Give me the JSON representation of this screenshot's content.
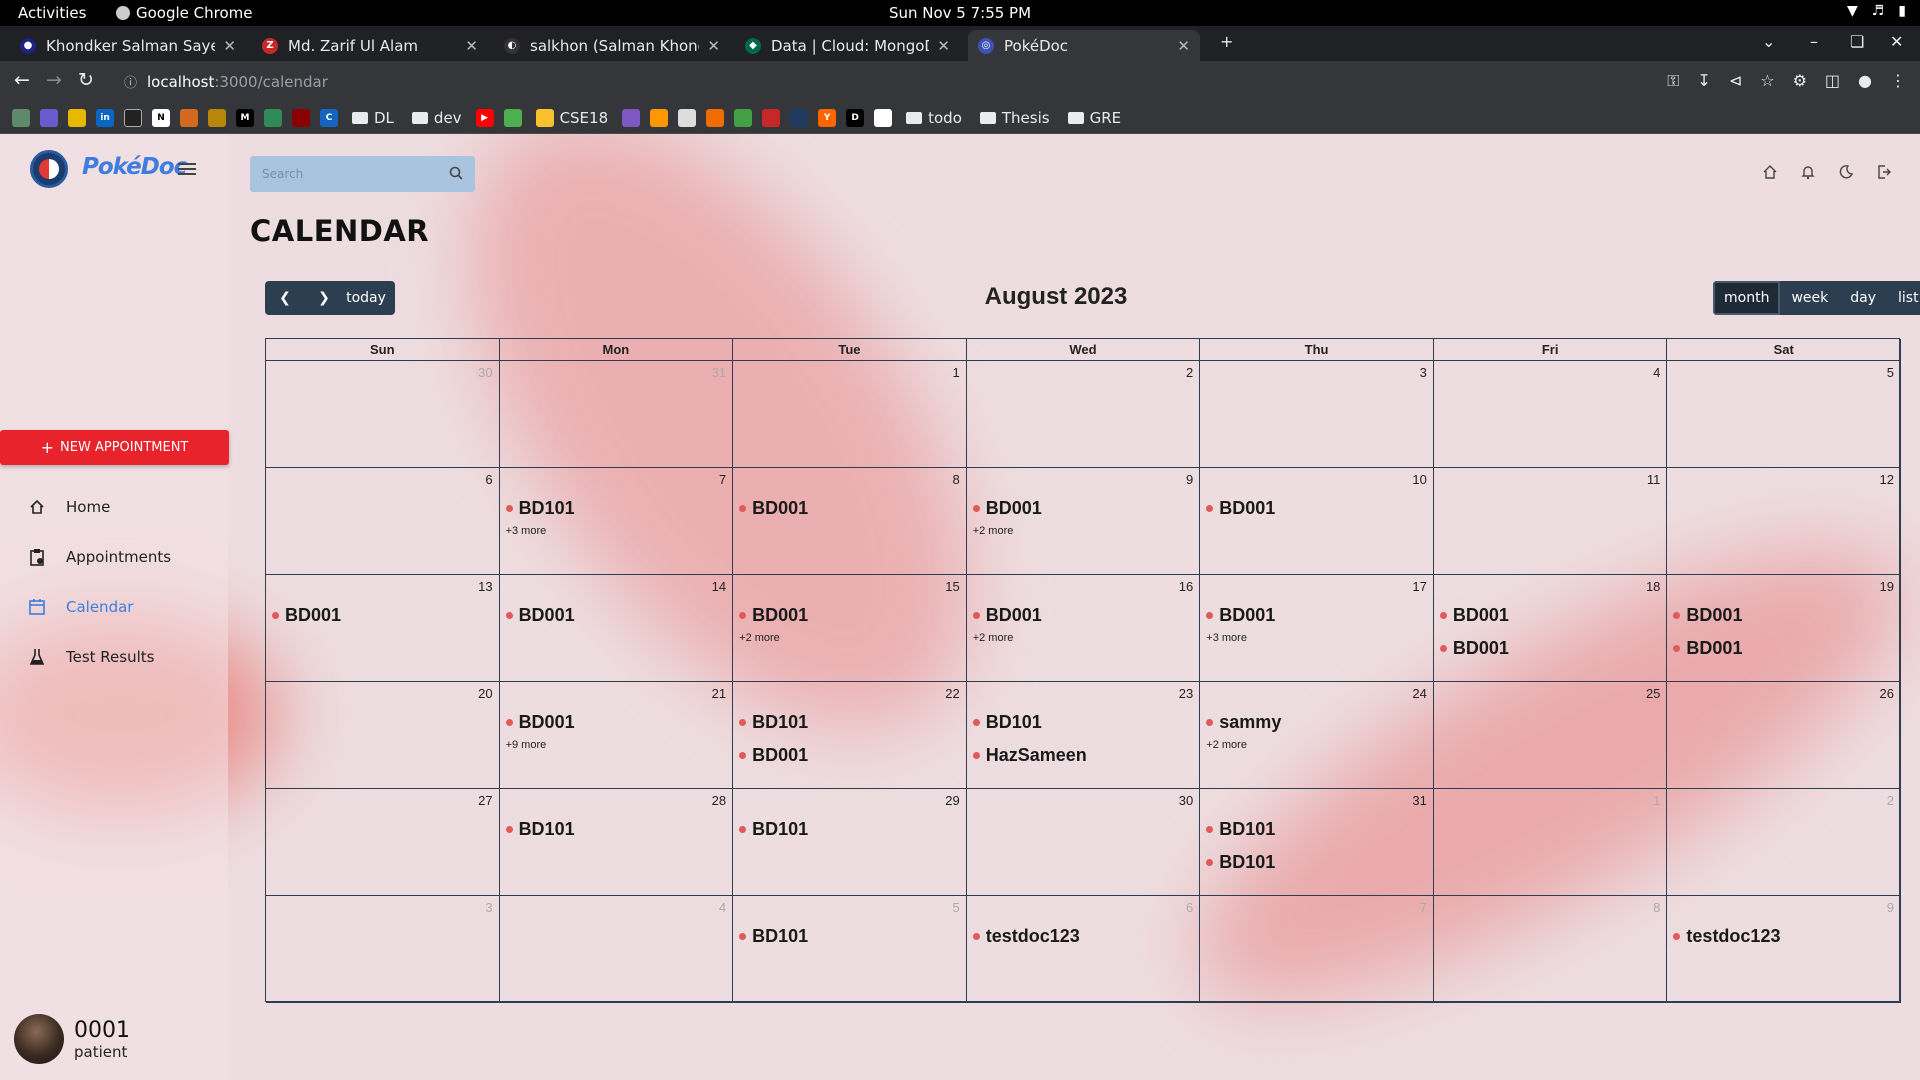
{
  "os_bar": {
    "activities": "Activities",
    "app_name": "Google Chrome",
    "clock": "Sun Nov 5   7:55 PM"
  },
  "tabs": [
    {
      "title": "Khondker Salman Sayeed",
      "fav_color": "#1a237e",
      "fav_glyph": "●"
    },
    {
      "title": "Md. Zarif Ul Alam",
      "fav_color": "#c62828",
      "fav_glyph": "Z"
    },
    {
      "title": "salkhon (Salman Khondk",
      "fav_color": "#333333",
      "fav_glyph": "◐"
    },
    {
      "title": "Data | Cloud: MongoDB C",
      "fav_color": "#00684a",
      "fav_glyph": "◆"
    },
    {
      "title": "PokéDoc",
      "fav_color": "#3f51b5",
      "fav_glyph": "◎"
    }
  ],
  "address": {
    "host": "localhost",
    "path": ":3000/calendar"
  },
  "bookmark_folders": [
    "DL",
    "dev",
    "CSE18",
    "todo",
    "Thesis",
    "GRE"
  ],
  "app": {
    "brand": "PokéDoc"
  },
  "sidebar": {
    "new_button": "NEW APPOINTMENT",
    "items": [
      {
        "label": "Home",
        "icon": "home-icon"
      },
      {
        "label": "Appointments",
        "icon": "clipboard-icon"
      },
      {
        "label": "Calendar",
        "icon": "calendar-icon",
        "selected": true
      },
      {
        "label": "Test Results",
        "icon": "flask-icon"
      }
    ],
    "user": {
      "name": "0001",
      "role": "patient"
    }
  },
  "search": {
    "placeholder": "Search"
  },
  "page_title": "CALENDAR",
  "calendar": {
    "title": "August 2023",
    "today_label": "today",
    "views": [
      "month",
      "week",
      "day",
      "list"
    ],
    "active_view": "month",
    "day_headers": [
      "Sun",
      "Mon",
      "Tue",
      "Wed",
      "Thu",
      "Fri",
      "Sat"
    ],
    "weeks": [
      [
        {
          "d": "30",
          "o": true,
          "ev": []
        },
        {
          "d": "31",
          "o": true,
          "ev": []
        },
        {
          "d": "1",
          "ev": []
        },
        {
          "d": "2",
          "ev": []
        },
        {
          "d": "3",
          "ev": []
        },
        {
          "d": "4",
          "ev": []
        },
        {
          "d": "5",
          "ev": []
        }
      ],
      [
        {
          "d": "6",
          "ev": []
        },
        {
          "d": "7",
          "ev": [
            "BD101"
          ],
          "more": "+3 more"
        },
        {
          "d": "8",
          "ev": [
            "BD001"
          ]
        },
        {
          "d": "9",
          "ev": [
            "BD001"
          ],
          "more": "+2 more"
        },
        {
          "d": "10",
          "ev": [
            "BD001"
          ]
        },
        {
          "d": "11",
          "ev": []
        },
        {
          "d": "12",
          "ev": []
        }
      ],
      [
        {
          "d": "13",
          "ev": [
            "BD001"
          ]
        },
        {
          "d": "14",
          "ev": [
            "BD001"
          ]
        },
        {
          "d": "15",
          "ev": [
            "BD001"
          ],
          "more": "+2 more"
        },
        {
          "d": "16",
          "ev": [
            "BD001"
          ],
          "more": "+2 more"
        },
        {
          "d": "17",
          "ev": [
            "BD001"
          ],
          "more": "+3 more"
        },
        {
          "d": "18",
          "ev": [
            "BD001",
            "BD001"
          ]
        },
        {
          "d": "19",
          "ev": [
            "BD001",
            "BD001"
          ]
        }
      ],
      [
        {
          "d": "20",
          "ev": []
        },
        {
          "d": "21",
          "ev": [
            "BD001"
          ],
          "more": "+9 more"
        },
        {
          "d": "22",
          "ev": [
            "BD101",
            "BD001"
          ]
        },
        {
          "d": "23",
          "ev": [
            "BD101",
            "HazSameen"
          ]
        },
        {
          "d": "24",
          "ev": [
            "sammy"
          ],
          "more": "+2 more"
        },
        {
          "d": "25",
          "ev": []
        },
        {
          "d": "26",
          "ev": []
        }
      ],
      [
        {
          "d": "27",
          "ev": []
        },
        {
          "d": "28",
          "ev": [
            "BD101"
          ]
        },
        {
          "d": "29",
          "ev": [
            "BD101"
          ]
        },
        {
          "d": "30",
          "ev": []
        },
        {
          "d": "31",
          "ev": [
            "BD101",
            "BD101"
          ]
        },
        {
          "d": "1",
          "o": true,
          "ev": []
        },
        {
          "d": "2",
          "o": true,
          "ev": []
        }
      ],
      [
        {
          "d": "3",
          "o": true,
          "ev": []
        },
        {
          "d": "4",
          "o": true,
          "ev": []
        },
        {
          "d": "5",
          "o": true,
          "ev": [
            "BD101"
          ]
        },
        {
          "d": "6",
          "o": true,
          "ev": [
            "testdoc123"
          ]
        },
        {
          "d": "7",
          "o": true,
          "ev": []
        },
        {
          "d": "8",
          "o": true,
          "ev": []
        },
        {
          "d": "9",
          "o": true,
          "ev": [
            "testdoc123"
          ]
        }
      ]
    ]
  }
}
